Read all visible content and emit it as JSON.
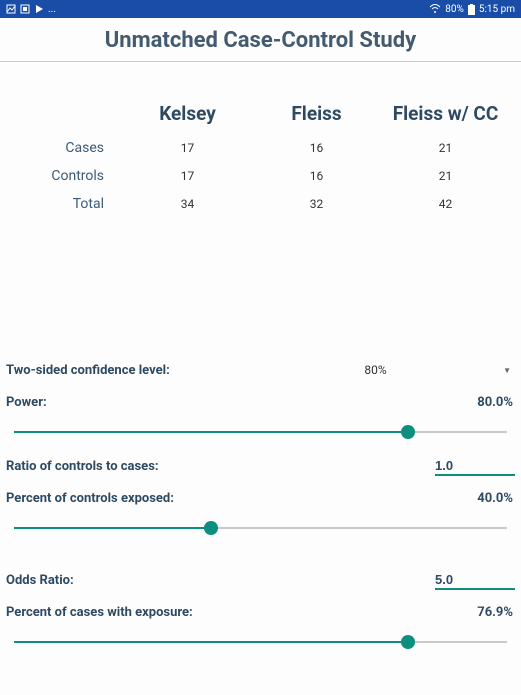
{
  "status": {
    "battery": "80%",
    "time": "5:15 pm"
  },
  "title": "Unmatched Case-Control Study",
  "table": {
    "cols": [
      "Kelsey",
      "Fleiss",
      "Fleiss w/ CC"
    ],
    "rows": [
      {
        "label": "Cases",
        "vals": [
          "17",
          "16",
          "21"
        ]
      },
      {
        "label": "Controls",
        "vals": [
          "17",
          "16",
          "21"
        ]
      },
      {
        "label": "Total",
        "vals": [
          "34",
          "32",
          "42"
        ]
      }
    ]
  },
  "params": {
    "conf_label": "Two-sided confidence level:",
    "conf_value": "80%",
    "power_label": "Power:",
    "power_value": "80.0%",
    "power_pct": 80,
    "ratio_label": "Ratio of controls to cases:",
    "ratio_value": "1.0",
    "pctrl_label": "Percent of controls exposed:",
    "pctrl_value": "40.0%",
    "pctrl_pct": 40,
    "odds_label": "Odds Ratio:",
    "odds_value": "5.0",
    "pcase_label": "Percent of cases with exposure:",
    "pcase_value": "76.9%",
    "pcase_pct": 80
  }
}
